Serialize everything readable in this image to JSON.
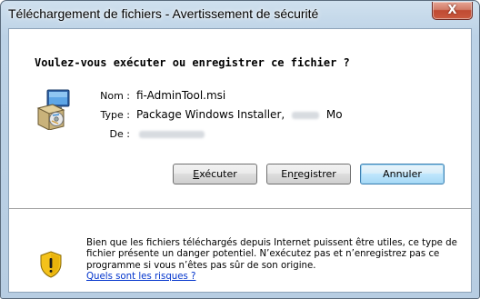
{
  "window": {
    "title": "Téléchargement de fichiers - Avertissement de sécurité",
    "close_glyph": "X"
  },
  "dialog": {
    "question": "Voulez-vous exécuter ou enregistrer ce fichier ?",
    "file_icon": "windows-installer-package-icon",
    "fields": {
      "name_label": "Nom :",
      "name_value": "fi-AdminTool.msi",
      "type_label": "Type :",
      "type_value": "Package Windows Installer,",
      "type_unit": "Mo",
      "from_label": "De :"
    },
    "buttons": {
      "run": {
        "prefix": "",
        "accel": "E",
        "rest": "xécuter"
      },
      "save": {
        "prefix": "En",
        "accel": "r",
        "rest": "egistrer"
      },
      "cancel": "Annuler"
    },
    "warning": {
      "icon": "shield-warning-icon",
      "text": "Bien que les fichiers téléchargés depuis Internet puissent être utiles, ce type de fichier présente un danger potentiel. N’exécutez pas et n’enregistrez pas ce programme si vous n’êtes pas sûr de son origine.",
      "link": "Quels sont les risques ?"
    }
  },
  "colors": {
    "frame": "#bcd2e6",
    "close_button": "#c9593f",
    "default_button_border": "#3c7fb1",
    "link": "#0033cc"
  }
}
